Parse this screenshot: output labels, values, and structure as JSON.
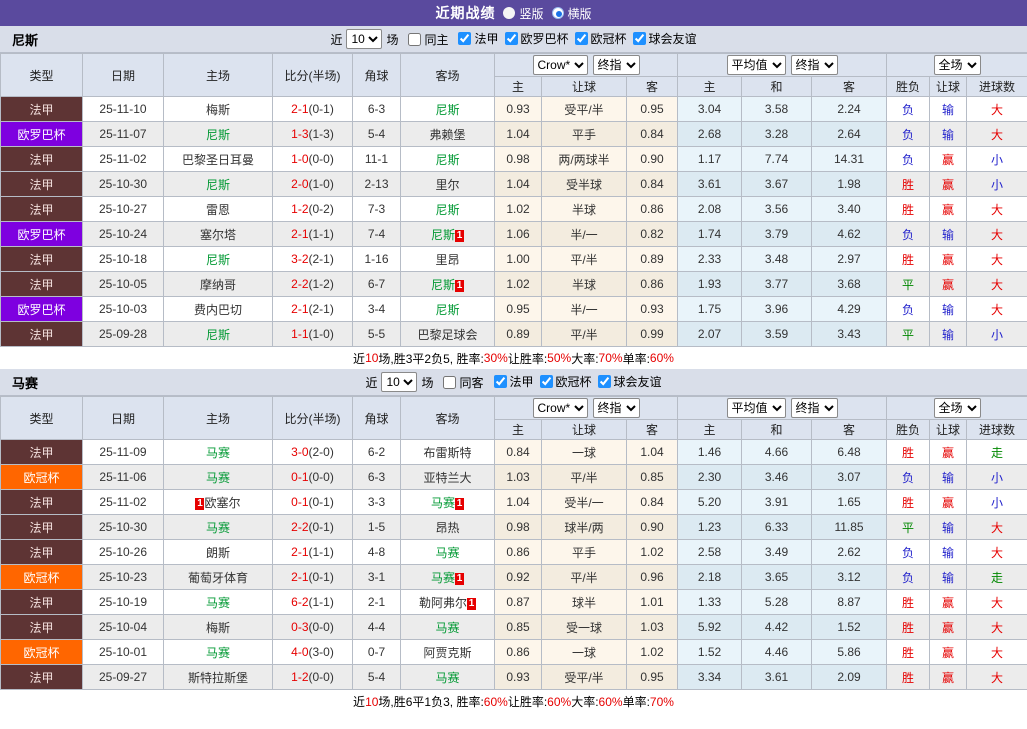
{
  "title_bar": {
    "title": "近期战绩",
    "vertical_label": "竖版",
    "horizontal_label": "横版",
    "selected_layout": "横版",
    "bg_color": "#5a4a9e"
  },
  "filters": [
    {
      "team": "尼斯",
      "near_label": "近",
      "count": "10",
      "games_label": "场",
      "same_label": "同主",
      "leagues": [
        "法甲",
        "欧罗巴杯",
        "欧冠杯",
        "球会友谊"
      ]
    },
    {
      "team": "马赛",
      "near_label": "近",
      "count": "10",
      "games_label": "场",
      "same_label": "同客",
      "leagues": [
        "法甲",
        "欧冠杯",
        "球会友谊"
      ]
    }
  ],
  "table_header": {
    "left_cols": [
      "类型",
      "日期",
      "主场",
      "比分(半场)",
      "角球",
      "客场"
    ],
    "sub_cols": [
      "主",
      "让球",
      "客",
      "主",
      "和",
      "客",
      "胜负",
      "让球",
      "进球数"
    ],
    "selects": {
      "company": "Crow*",
      "final": "终指",
      "average": "平均值",
      "scope": "全场"
    }
  },
  "league_colors": {
    "法甲": "#5e3434",
    "欧罗巴杯": "#7e00e0",
    "欧冠杯": "#ff6600"
  },
  "league_text_colors": {
    "法甲": "#f2dedc",
    "欧罗巴杯": "#ffffff",
    "欧冠杯": "#ffffff"
  },
  "outcome_colors": {
    "胜": "#e60000",
    "平": "#008800",
    "负": "#2222cc",
    "赢": "#e60000",
    "输": "#2222cc",
    "大": "#e60000",
    "小": "#2222cc",
    "走": "#008800"
  },
  "accent": {
    "team_green": "#009933",
    "score_red": "#e60000",
    "badge_red": "#e60000"
  },
  "tables": [
    {
      "team": "尼斯",
      "rows": [
        {
          "league": "法甲",
          "date": "25-11-10",
          "home": "梅斯",
          "away": "尼斯",
          "away_team": true,
          "score": "2-1",
          "half": "(0-1)",
          "corner": "6-3",
          "let": [
            "0.93",
            "受平/半",
            "0.95"
          ],
          "odds": [
            "3.04",
            "3.58",
            "2.24"
          ],
          "res": [
            "负",
            "输",
            "大"
          ]
        },
        {
          "league": "欧罗巴杯",
          "date": "25-11-07",
          "home": "尼斯",
          "home_team": true,
          "away": "弗赖堡",
          "score": "1-3",
          "half": "(1-3)",
          "corner": "5-4",
          "let": [
            "1.04",
            "平手",
            "0.84"
          ],
          "odds": [
            "2.68",
            "3.28",
            "2.64"
          ],
          "res": [
            "负",
            "输",
            "大"
          ]
        },
        {
          "league": "法甲",
          "date": "25-11-02",
          "home": "巴黎圣日耳曼",
          "away": "尼斯",
          "away_team": true,
          "score": "1-0",
          "half": "(0-0)",
          "corner": "11-1",
          "let": [
            "0.98",
            "两/两球半",
            "0.90"
          ],
          "odds": [
            "1.17",
            "7.74",
            "14.31"
          ],
          "res": [
            "负",
            "赢",
            "小"
          ]
        },
        {
          "league": "法甲",
          "date": "25-10-30",
          "home": "尼斯",
          "home_team": true,
          "away": "里尔",
          "score": "2-0",
          "half": "(1-0)",
          "corner": "2-13",
          "let": [
            "1.04",
            "受半球",
            "0.84"
          ],
          "odds": [
            "3.61",
            "3.67",
            "1.98"
          ],
          "res": [
            "胜",
            "赢",
            "小"
          ]
        },
        {
          "league": "法甲",
          "date": "25-10-27",
          "home": "雷恩",
          "away": "尼斯",
          "away_team": true,
          "score": "1-2",
          "half": "(0-2)",
          "corner": "7-3",
          "let": [
            "1.02",
            "半球",
            "0.86"
          ],
          "odds": [
            "2.08",
            "3.56",
            "3.40"
          ],
          "res": [
            "胜",
            "赢",
            "大"
          ]
        },
        {
          "league": "欧罗巴杯",
          "date": "25-10-24",
          "home": "塞尔塔",
          "away": "尼斯",
          "away_team": true,
          "away_badge": "after",
          "score": "2-1",
          "half": "(1-1)",
          "corner": "7-4",
          "let": [
            "1.06",
            "半/一",
            "0.82"
          ],
          "odds": [
            "1.74",
            "3.79",
            "4.62"
          ],
          "res": [
            "负",
            "输",
            "大"
          ]
        },
        {
          "league": "法甲",
          "date": "25-10-18",
          "home": "尼斯",
          "home_team": true,
          "away": "里昂",
          "score": "3-2",
          "half": "(2-1)",
          "corner": "1-16",
          "let": [
            "1.00",
            "平/半",
            "0.89"
          ],
          "odds": [
            "2.33",
            "3.48",
            "2.97"
          ],
          "res": [
            "胜",
            "赢",
            "大"
          ]
        },
        {
          "league": "法甲",
          "date": "25-10-05",
          "home": "摩纳哥",
          "away": "尼斯",
          "away_team": true,
          "away_badge": "after",
          "score": "2-2",
          "half": "(1-2)",
          "corner": "6-7",
          "let": [
            "1.02",
            "半球",
            "0.86"
          ],
          "odds": [
            "1.93",
            "3.77",
            "3.68"
          ],
          "res": [
            "平",
            "赢",
            "大"
          ]
        },
        {
          "league": "欧罗巴杯",
          "date": "25-10-03",
          "home": "费内巴切",
          "away": "尼斯",
          "away_team": true,
          "score": "2-1",
          "half": "(2-1)",
          "corner": "3-4",
          "let": [
            "0.95",
            "半/一",
            "0.93"
          ],
          "odds": [
            "1.75",
            "3.96",
            "4.29"
          ],
          "res": [
            "负",
            "输",
            "大"
          ]
        },
        {
          "league": "法甲",
          "date": "25-09-28",
          "home": "尼斯",
          "home_team": true,
          "away": "巴黎足球会",
          "score": "1-1",
          "half": "(1-0)",
          "corner": "5-5",
          "let": [
            "0.89",
            "平/半",
            "0.99"
          ],
          "odds": [
            "2.07",
            "3.59",
            "3.43"
          ],
          "res": [
            "平",
            "输",
            "小"
          ]
        }
      ],
      "summary": {
        "segments": [
          {
            "t": "近",
            "c": "k"
          },
          {
            "t": "10",
            "c": "r"
          },
          {
            "t": "场,胜3平2负5, 胜率:",
            "c": "k"
          },
          {
            "t": "30%",
            "c": "r"
          },
          {
            "t": " 让胜率:",
            "c": "k"
          },
          {
            "t": "50%",
            "c": "r"
          },
          {
            "t": " 大率:",
            "c": "k"
          },
          {
            "t": "70%",
            "c": "r"
          },
          {
            "t": " 单率:",
            "c": "k"
          },
          {
            "t": "60%",
            "c": "r"
          }
        ]
      }
    },
    {
      "team": "马赛",
      "rows": [
        {
          "league": "法甲",
          "date": "25-11-09",
          "home": "马赛",
          "home_team": true,
          "away": "布雷斯特",
          "score": "3-0",
          "half": "(2-0)",
          "corner": "6-2",
          "let": [
            "0.84",
            "一球",
            "1.04"
          ],
          "odds": [
            "1.46",
            "4.66",
            "6.48"
          ],
          "res": [
            "胜",
            "赢",
            "走"
          ]
        },
        {
          "league": "欧冠杯",
          "date": "25-11-06",
          "home": "马赛",
          "home_team": true,
          "away": "亚特兰大",
          "score": "0-1",
          "half": "(0-0)",
          "corner": "6-3",
          "let": [
            "1.03",
            "平/半",
            "0.85"
          ],
          "odds": [
            "2.30",
            "3.46",
            "3.07"
          ],
          "res": [
            "负",
            "输",
            "小"
          ]
        },
        {
          "league": "法甲",
          "date": "25-11-02",
          "home": "欧塞尔",
          "home_badge": "before",
          "away": "马赛",
          "away_team": true,
          "away_badge": "after",
          "score": "0-1",
          "half": "(0-1)",
          "corner": "3-3",
          "let": [
            "1.04",
            "受半/一",
            "0.84"
          ],
          "odds": [
            "5.20",
            "3.91",
            "1.65"
          ],
          "res": [
            "胜",
            "赢",
            "小"
          ]
        },
        {
          "league": "法甲",
          "date": "25-10-30",
          "home": "马赛",
          "home_team": true,
          "away": "昂热",
          "score": "2-2",
          "half": "(0-1)",
          "corner": "1-5",
          "let": [
            "0.98",
            "球半/两",
            "0.90"
          ],
          "odds": [
            "1.23",
            "6.33",
            "11.85"
          ],
          "res": [
            "平",
            "输",
            "大"
          ]
        },
        {
          "league": "法甲",
          "date": "25-10-26",
          "home": "朗斯",
          "away": "马赛",
          "away_team": true,
          "score": "2-1",
          "half": "(1-1)",
          "corner": "4-8",
          "let": [
            "0.86",
            "平手",
            "1.02"
          ],
          "odds": [
            "2.58",
            "3.49",
            "2.62"
          ],
          "res": [
            "负",
            "输",
            "大"
          ]
        },
        {
          "league": "欧冠杯",
          "date": "25-10-23",
          "home": "葡萄牙体育",
          "away": "马赛",
          "away_team": true,
          "away_badge": "after",
          "score": "2-1",
          "half": "(0-1)",
          "corner": "3-1",
          "let": [
            "0.92",
            "平/半",
            "0.96"
          ],
          "odds": [
            "2.18",
            "3.65",
            "3.12"
          ],
          "res": [
            "负",
            "输",
            "走"
          ]
        },
        {
          "league": "法甲",
          "date": "25-10-19",
          "home": "马赛",
          "home_team": true,
          "away": "勒阿弗尔",
          "away_badge": "after",
          "score": "6-2",
          "half": "(1-1)",
          "corner": "2-1",
          "let": [
            "0.87",
            "球半",
            "1.01"
          ],
          "odds": [
            "1.33",
            "5.28",
            "8.87"
          ],
          "res": [
            "胜",
            "赢",
            "大"
          ]
        },
        {
          "league": "法甲",
          "date": "25-10-04",
          "home": "梅斯",
          "away": "马赛",
          "away_team": true,
          "score": "0-3",
          "half": "(0-0)",
          "corner": "4-4",
          "let": [
            "0.85",
            "受一球",
            "1.03"
          ],
          "odds": [
            "5.92",
            "4.42",
            "1.52"
          ],
          "res": [
            "胜",
            "赢",
            "大"
          ]
        },
        {
          "league": "欧冠杯",
          "date": "25-10-01",
          "home": "马赛",
          "home_team": true,
          "away": "阿贾克斯",
          "score": "4-0",
          "half": "(3-0)",
          "corner": "0-7",
          "let": [
            "0.86",
            "一球",
            "1.02"
          ],
          "odds": [
            "1.52",
            "4.46",
            "5.86"
          ],
          "res": [
            "胜",
            "赢",
            "大"
          ]
        },
        {
          "league": "法甲",
          "date": "25-09-27",
          "home": "斯特拉斯堡",
          "away": "马赛",
          "away_team": true,
          "score": "1-2",
          "half": "(0-0)",
          "corner": "5-4",
          "let": [
            "0.93",
            "受平/半",
            "0.95"
          ],
          "odds": [
            "3.34",
            "3.61",
            "2.09"
          ],
          "res": [
            "胜",
            "赢",
            "大"
          ]
        }
      ],
      "summary": {
        "segments": [
          {
            "t": "近",
            "c": "k"
          },
          {
            "t": "10",
            "c": "r"
          },
          {
            "t": "场,胜6平1负3, 胜率:",
            "c": "k"
          },
          {
            "t": "60%",
            "c": "r"
          },
          {
            "t": " 让胜率:",
            "c": "k"
          },
          {
            "t": "60%",
            "c": "r"
          },
          {
            "t": " 大率:",
            "c": "k"
          },
          {
            "t": "60%",
            "c": "r"
          },
          {
            "t": " 单率:",
            "c": "k"
          },
          {
            "t": "70%",
            "c": "r"
          }
        ]
      }
    }
  ]
}
